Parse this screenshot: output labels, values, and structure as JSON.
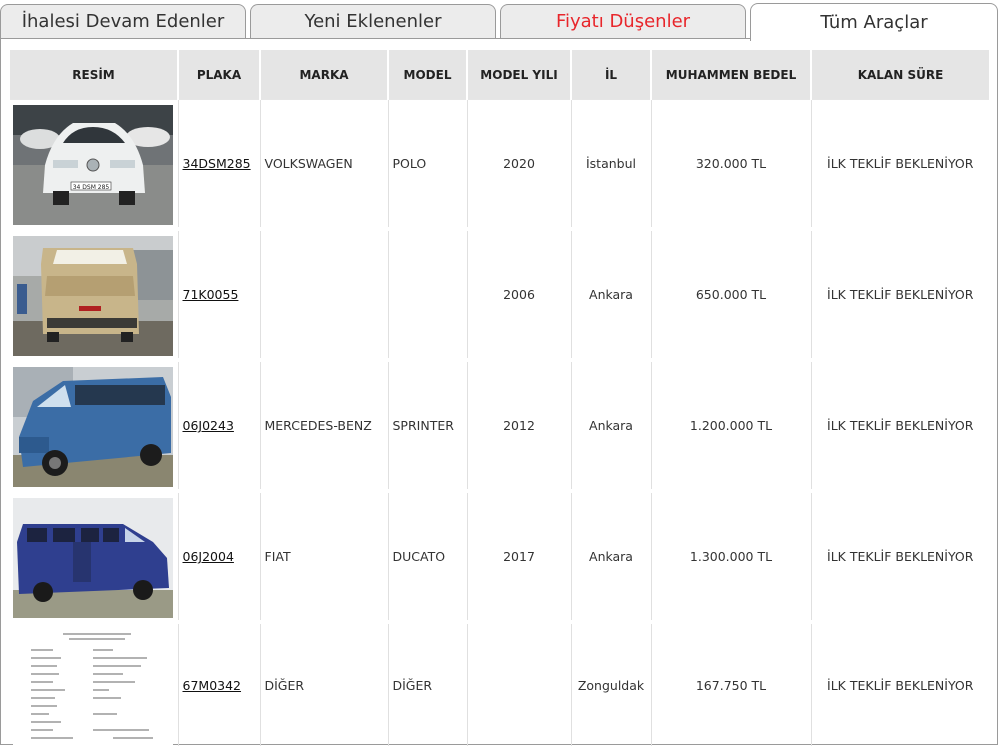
{
  "tabs": [
    {
      "label": "İhalesi Devam Edenler"
    },
    {
      "label": "Yeni Eklenenler"
    },
    {
      "label": "Fiyatı Düşenler"
    },
    {
      "label": "Tüm Araçlar"
    }
  ],
  "table": {
    "headers": [
      "RESİM",
      "PLAKA",
      "MARKA",
      "MODEL",
      "MODEL YILI",
      "İL",
      "MUHAMMEN BEDEL",
      "KALAN SÜRE"
    ],
    "rows": [
      {
        "plaka": "34DSM285",
        "marka": "VOLKSWAGEN",
        "model": "POLO",
        "yil": "2020",
        "il": "İstanbul",
        "bedel": "320.000 TL",
        "sure": "İLK TEKLİF BEKLENİYOR",
        "photo_plate": "34 DSM 285"
      },
      {
        "plaka": "71K0055",
        "marka": "",
        "model": "",
        "yil": "2006",
        "il": "Ankara",
        "bedel": "650.000 TL",
        "sure": "İLK TEKLİF BEKLENİYOR"
      },
      {
        "plaka": "06J0243",
        "marka": "MERCEDES-BENZ",
        "model": "SPRINTER",
        "yil": "2012",
        "il": "Ankara",
        "bedel": "1.200.000 TL",
        "sure": "İLK TEKLİF BEKLENİYOR"
      },
      {
        "plaka": "06J2004",
        "marka": "FIAT",
        "model": "DUCATO",
        "yil": "2017",
        "il": "Ankara",
        "bedel": "1.300.000 TL",
        "sure": "İLK TEKLİF BEKLENİYOR"
      },
      {
        "plaka": "67M0342",
        "marka": "DİĞER",
        "model": "DİĞER",
        "yil": "",
        "il": "Zonguldak",
        "bedel": "167.750 TL",
        "sure": "İLK TEKLİF BEKLENİYOR"
      }
    ]
  },
  "colors": {
    "active_tab_bg": "#ffffff",
    "tab_bg": "#ececec",
    "header_bg": "#e5e5e5",
    "price_drop_tab": "#e8262b"
  }
}
